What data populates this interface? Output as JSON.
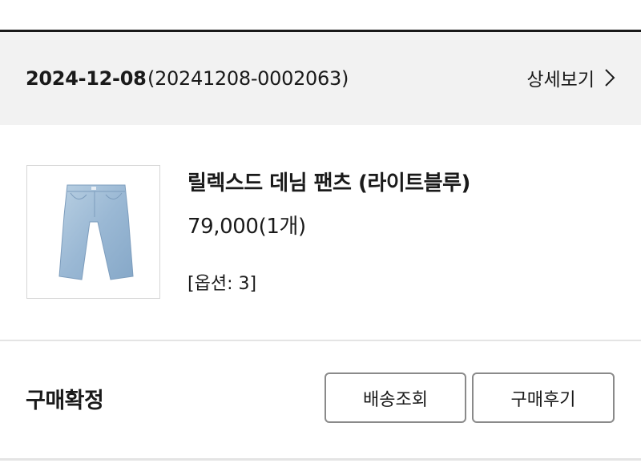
{
  "order": {
    "date": "2024-12-08",
    "number": "(20241208-0002063)",
    "detail_label": "상세보기",
    "detail_icon": "chevron-right-icon"
  },
  "product": {
    "name": "릴렉스드 데님 팬츠 (라이트블루)",
    "price": "79,000(1개)",
    "option": "[옵션: 3]",
    "image_icon": "denim-pants-image"
  },
  "footer": {
    "status": "구매확정",
    "tracking_label": "배송조회",
    "review_label": "구매후기"
  }
}
